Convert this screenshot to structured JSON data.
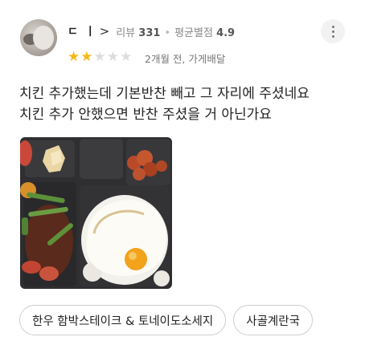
{
  "review": {
    "nickname": "ㄷ ㅣ",
    "chevron": ">",
    "review_label": "리뷰",
    "review_count": "331",
    "avg_label": "평균별점",
    "avg_rating": "4.9",
    "rating": 2,
    "rating_max": 5,
    "date_text": "2개월 전, 가게배달",
    "text_lines": [
      "치킨 추가했는데 기본반찬 빼고 그 자리에 주셨네요",
      "치킨 추가 안했으면 반찬 주셨을 거 아닌가요"
    ],
    "tags": [
      "한우 함박스테이크 & 토네이도소세지",
      "사골계란국"
    ]
  },
  "colors": {
    "star_on": "#f5b916",
    "star_off": "#dddddd"
  },
  "icons": {
    "more": "more-vertical-icon",
    "star": "star-icon"
  }
}
